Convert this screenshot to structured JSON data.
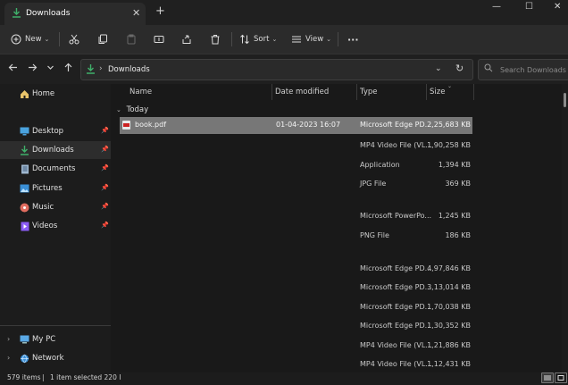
{
  "tab": {
    "title": "Downloads",
    "close": "✕",
    "new_tab": "+"
  },
  "window_controls": {
    "minimize": "—",
    "maximize": "☐",
    "close": "✕"
  },
  "toolbar": {
    "new_label": "New",
    "sort_label": "Sort",
    "view_label": "View",
    "more": "···",
    "caret": "⌄"
  },
  "address": {
    "crumb": "Downloads",
    "separator": "›",
    "dropdown": "⌄",
    "refresh": "↻"
  },
  "search": {
    "placeholder": "Search Downloads"
  },
  "nav": {
    "home": "Home",
    "quick": [
      {
        "label": "Desktop",
        "icon": "desktop-icon"
      },
      {
        "label": "Downloads",
        "icon": "download-icon"
      },
      {
        "label": "Documents",
        "icon": "documents-icon"
      },
      {
        "label": "Pictures",
        "icon": "pictures-icon"
      },
      {
        "label": "Music",
        "icon": "music-icon"
      },
      {
        "label": "Videos",
        "icon": "videos-icon"
      }
    ],
    "pin": "📌",
    "my_pc": "My PC",
    "network": "Network"
  },
  "columns": {
    "name": "Name",
    "date": "Date modified",
    "type": "Type",
    "size": "Size"
  },
  "group": {
    "label": "Today"
  },
  "files": [
    {
      "name": "book.pdf",
      "date": "01-04-2023 16:07",
      "type": "Microsoft Edge PD...",
      "size": "2,25,683 KB"
    },
    {
      "name": "",
      "date": "",
      "type": "MP4 Video File (VL...",
      "size": "1,90,258 KB"
    },
    {
      "name": "",
      "date": "",
      "type": "Application",
      "size": "1,394 KB"
    },
    {
      "name": "",
      "date": "",
      "type": "JPG File",
      "size": "369 KB"
    },
    {
      "name": "",
      "date": "",
      "type": "",
      "size": ""
    },
    {
      "name": "",
      "date": "",
      "type": "Microsoft PowerPo...",
      "size": "1,245 KB"
    },
    {
      "name": "",
      "date": "",
      "type": "PNG File",
      "size": "186 KB"
    },
    {
      "name": "",
      "date": "",
      "type": "",
      "size": ""
    },
    {
      "name": "",
      "date": "",
      "type": "Microsoft Edge PD...",
      "size": "4,97,846 KB"
    },
    {
      "name": "",
      "date": "",
      "type": "Microsoft Edge PD...",
      "size": "3,13,014 KB"
    },
    {
      "name": "",
      "date": "",
      "type": "Microsoft Edge PD...",
      "size": "1,70,038 KB"
    },
    {
      "name": "",
      "date": "",
      "type": "Microsoft Edge PD...",
      "size": "1,30,352 KB"
    },
    {
      "name": "",
      "date": "",
      "type": "MP4 Video File (VL...",
      "size": "1,21,886 KB"
    },
    {
      "name": "",
      "date": "",
      "type": "MP4 Video File (VL...",
      "size": "1,12,431 KB"
    }
  ],
  "status": {
    "count": "579 items",
    "divider": "|",
    "selected": "1 item selected  220 I"
  },
  "colors": {
    "accent": "#3fb06a",
    "selection": "#777777",
    "background": "#191919"
  }
}
